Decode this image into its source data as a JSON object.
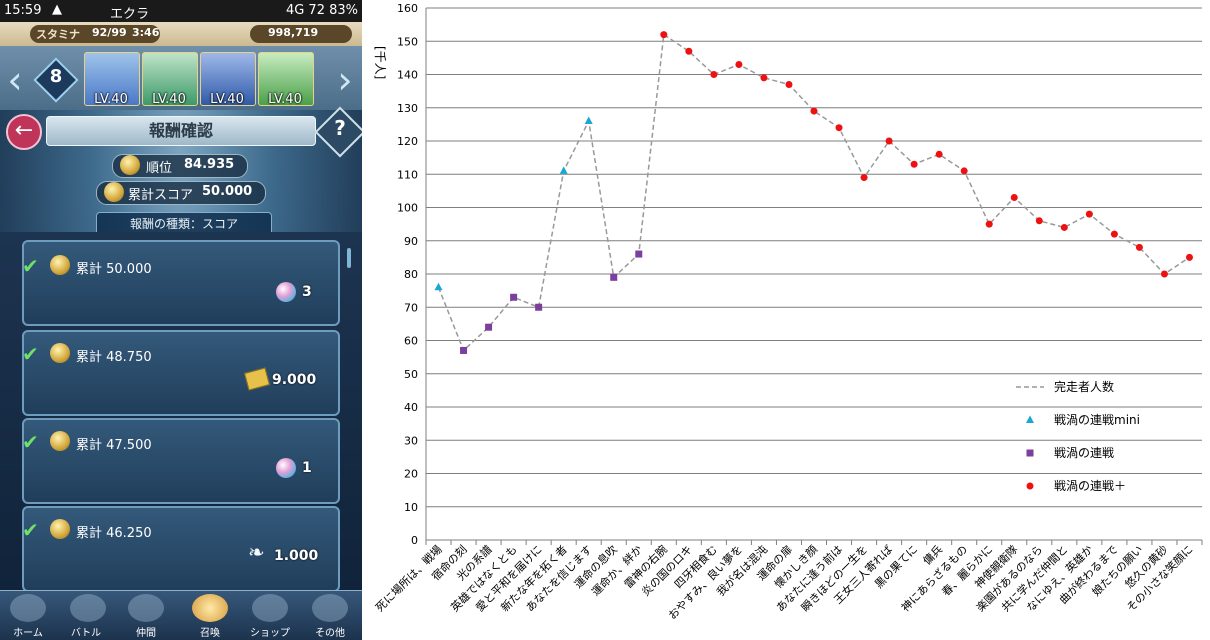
{
  "status_bar": {
    "time": "15:59",
    "app_name": "エクラ",
    "right": "4G  72  83%"
  },
  "game": {
    "stamina_label": "スタミナ",
    "stamina": "92/99",
    "stamina_timer": "3:46",
    "feathers": "998,719",
    "team_number": "8",
    "heroes": [
      {
        "level": "LV.40",
        "color": "#4a78c8"
      },
      {
        "level": "LV.40",
        "color": "#3c9a6a"
      },
      {
        "level": "LV.40",
        "color": "#c84a4a"
      },
      {
        "level": "LV.40",
        "color": "#4aa04a"
      }
    ],
    "title": "報酬確認",
    "rank_label": "順位",
    "rank_value": "84.935",
    "score_label": "累計スコア",
    "score_value": "50.000",
    "reward_type": "報酬の種類：スコア",
    "rewards": [
      {
        "label": "累計 50.000",
        "qty": "3",
        "icon": "orb-icon"
      },
      {
        "label": "累計 48.750",
        "qty": "9.000",
        "icon": "badge-icon"
      },
      {
        "label": "累計 47.500",
        "qty": "1",
        "icon": "orb-icon"
      },
      {
        "label": "累計 46.250",
        "qty": "1.000",
        "icon": "feather-icon"
      }
    ],
    "nav": [
      "ホーム",
      "バトル",
      "仲間",
      "召喚",
      "ショップ",
      "その他"
    ]
  },
  "chart_data": {
    "type": "scatter",
    "ylabel": "[千人]",
    "ylim": [
      0,
      160
    ],
    "yticks": [
      0,
      10,
      20,
      30,
      40,
      50,
      60,
      70,
      80,
      90,
      100,
      110,
      120,
      130,
      140,
      150,
      160
    ],
    "categories": [
      "死に場所は、戦場",
      "宿命の刻",
      "光の系譜",
      "英雄ではなくとも",
      "愛と平和を届けに",
      "新たな年を拓く者",
      "あなたを信じます",
      "運命の息吹",
      "運命か、絆か",
      "雷神の右腕",
      "炎の国のロキ",
      "四牙相食む",
      "おやすみ、良い夢を",
      "我が名は混沌",
      "運命の扉",
      "懐かしき顔",
      "あなたに逢う前は",
      "瞬きほどの一生を",
      "王女三人寄れば",
      "黒の果てに",
      "傭兵",
      "神にあらざるもの",
      "春、麗らかに",
      "神使親衛隊",
      "楽園があるのなら",
      "共に学んだ仲間と",
      "なにゆえ、英雄か",
      "曲が終わるまで",
      "娘たちの願い",
      "悠久の黄砂",
      "その小さな笑顔に"
    ],
    "x_tick_labels": [
      "死に場所は、戦場",
      "宿命の刻",
      "光の系譜",
      "英雄ではなくとも",
      "愛と平和を届けに",
      "新たな年を拓く者",
      "あなたを信じます",
      "運命の息吹",
      "運命か、絆か",
      "雷神の右腕",
      "炎の国のロキ",
      "四牙相食む",
      "おやすみ、良い夢を",
      "我が名は混沌",
      "運命の扉",
      "懐かしき顔",
      "あなたに逢う前は",
      "瞬きほどの一生を",
      "王女三人寄れば",
      "黒の果てに",
      "傭兵",
      "神にあらざるもの",
      "春、麗らかに",
      "神使親衛隊",
      "楽園があるのなら",
      "共に学んだ仲間と",
      "なにゆえ、英雄か",
      "曲が終わるまで",
      "娘たちの願い",
      "悠久の黄砂",
      "その小さな笑顔に"
    ],
    "series": [
      {
        "name": "完走者人数",
        "style": "dashed-line",
        "color": "#999999",
        "values": [
          76,
          57,
          64,
          73,
          70,
          111,
          126,
          79,
          86,
          152,
          147,
          140,
          143,
          139,
          137,
          129,
          124,
          109,
          120,
          113,
          116,
          111,
          95,
          103,
          96,
          94,
          98,
          92,
          88,
          80,
          85
        ]
      },
      {
        "name": "戦渦の連戦mini",
        "marker": "triangle",
        "color": "#1aa7d6",
        "points": [
          [
            0,
            76
          ],
          [
            5,
            111
          ],
          [
            6,
            126
          ]
        ]
      },
      {
        "name": "戦渦の連戦",
        "marker": "square",
        "color": "#7b3f9e",
        "points": [
          [
            1,
            57
          ],
          [
            2,
            64
          ],
          [
            3,
            73
          ],
          [
            4,
            70
          ],
          [
            7,
            79
          ],
          [
            8,
            86
          ]
        ]
      },
      {
        "name": "戦渦の連戦＋",
        "marker": "circle",
        "color": "#ee1111",
        "points": [
          [
            9,
            152
          ],
          [
            10,
            147
          ],
          [
            11,
            140
          ],
          [
            12,
            143
          ],
          [
            13,
            139
          ],
          [
            14,
            137
          ],
          [
            15,
            129
          ],
          [
            16,
            124
          ],
          [
            17,
            109
          ],
          [
            18,
            120
          ],
          [
            19,
            113
          ],
          [
            20,
            116
          ],
          [
            21,
            111
          ],
          [
            22,
            95
          ],
          [
            23,
            103
          ],
          [
            24,
            96
          ],
          [
            25,
            94
          ],
          [
            26,
            98
          ],
          [
            27,
            92
          ],
          [
            28,
            88
          ],
          [
            29,
            80
          ],
          [
            30,
            85
          ]
        ]
      }
    ],
    "grid": true,
    "legend": "bottom-right"
  }
}
